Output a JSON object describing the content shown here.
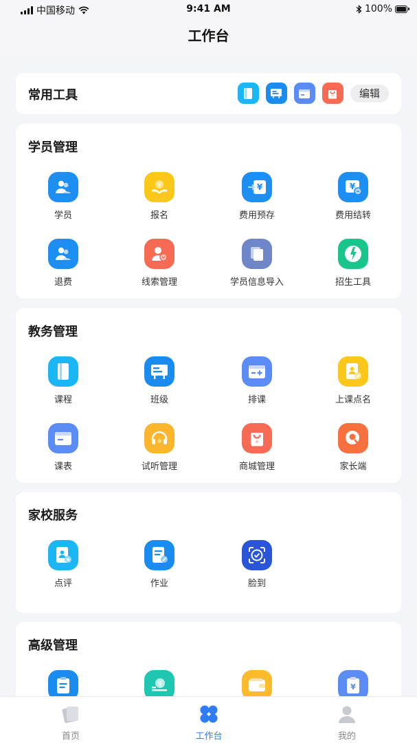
{
  "status_bar": {
    "carrier": "中国移动",
    "time": "9:41 AM",
    "battery": "100%"
  },
  "nav": {
    "title": "工作台"
  },
  "tools": {
    "title": "常用工具",
    "edit_label": "编辑",
    "icons": [
      {
        "icon": "book-icon",
        "color": "#1bb6f5"
      },
      {
        "icon": "class-board-icon",
        "color": "#1a8cf0"
      },
      {
        "icon": "calendar-icon",
        "color": "#5b8cf5"
      },
      {
        "icon": "shop-bag-icon",
        "color": "#f76a54"
      }
    ]
  },
  "sections": [
    {
      "title": "学员管理",
      "items": [
        {
          "label": "学员",
          "icon": "students-icon",
          "color": "#1d8ef2"
        },
        {
          "label": "报名",
          "icon": "enroll-icon",
          "color": "#fbc81a"
        },
        {
          "label": "费用预存",
          "icon": "prepay-icon",
          "color": "#1d8ef2"
        },
        {
          "label": "费用结转",
          "icon": "fee-transfer-icon",
          "color": "#1d8ef2"
        },
        {
          "label": "退费",
          "icon": "refund-icon",
          "color": "#1d8ef2"
        },
        {
          "label": "线索管理",
          "icon": "leads-icon",
          "color": "#f76a54"
        },
        {
          "label": "学员信息导入",
          "icon": "import-icon",
          "color": "#6f86c9"
        },
        {
          "label": "招生工具",
          "icon": "recruit-tool-icon",
          "color": "#19c58a"
        }
      ]
    },
    {
      "title": "教务管理",
      "items": [
        {
          "label": "课程",
          "icon": "book-icon",
          "color": "#1bb6f5"
        },
        {
          "label": "班级",
          "icon": "class-board-icon",
          "color": "#1a8cf0"
        },
        {
          "label": "排课",
          "icon": "schedule-icon",
          "color": "#5b8cf5"
        },
        {
          "label": "上课点名",
          "icon": "roll-call-icon",
          "color": "#fbc81a"
        },
        {
          "label": "课表",
          "icon": "calendar-icon",
          "color": "#5b8cf5"
        },
        {
          "label": "试听管理",
          "icon": "headphone-icon",
          "color": "#fbb62d"
        },
        {
          "label": "商城管理",
          "icon": "shop-bag-icon",
          "color": "#f76a54"
        },
        {
          "label": "家长端",
          "icon": "parent-icon",
          "color": "#f7713f"
        }
      ]
    },
    {
      "title": "家校服务",
      "items": [
        {
          "label": "点评",
          "icon": "review-icon",
          "color": "#1bb6f5"
        },
        {
          "label": "作业",
          "icon": "homework-icon",
          "color": "#1a8cf0"
        },
        {
          "label": "脸到",
          "icon": "face-check-icon",
          "color": "#2a55d8"
        }
      ]
    },
    {
      "title": "高级管理",
      "items": [
        {
          "label": "",
          "icon": "clipboard-icon",
          "color": "#1a8cf0"
        },
        {
          "label": "",
          "icon": "finance-icon",
          "color": "#1fc6b2"
        },
        {
          "label": "",
          "icon": "wallet-icon",
          "color": "#fbbb2a"
        },
        {
          "label": "",
          "icon": "receipt-icon",
          "color": "#5b8cf5"
        }
      ]
    }
  ],
  "tab_bar": {
    "tabs": [
      {
        "label": "首页",
        "icon": "home-cards-icon"
      },
      {
        "label": "工作台",
        "icon": "workbench-icon",
        "active": true
      },
      {
        "label": "我的",
        "icon": "profile-icon"
      }
    ]
  }
}
